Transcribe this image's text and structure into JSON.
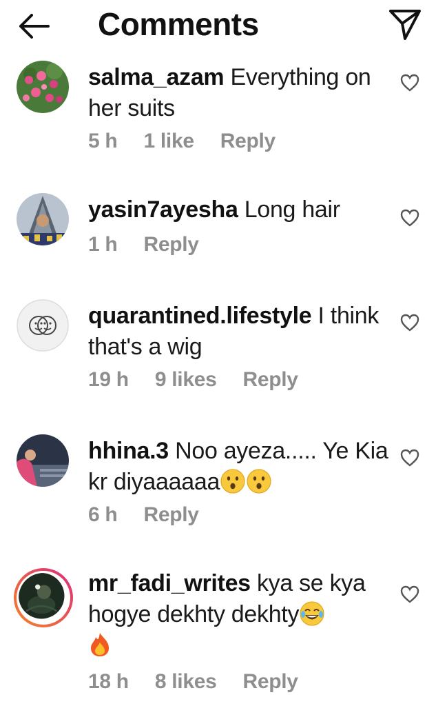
{
  "header": {
    "title": "Comments"
  },
  "comments": [
    {
      "username": "salma_azam",
      "text": "Everything on her suits",
      "time": "5 h",
      "likes": "1 like",
      "reply": "Reply"
    },
    {
      "username": "yasin7ayesha",
      "text": "Long hair",
      "time": "1 h",
      "likes": "",
      "reply": "Reply"
    },
    {
      "username": "quarantined.lifestyle",
      "text": "I think that's a wig",
      "time": "19 h",
      "likes": "9 likes",
      "reply": "Reply"
    },
    {
      "username": "hhina.3",
      "text": "Noo ayeza..... Ye Kia kr diyaaaaaa",
      "time": "6 h",
      "likes": "",
      "reply": "Reply"
    },
    {
      "username": "mr_fadi_writes",
      "text": "kya se kya hogye dekhty dekhty",
      "time": "18 h",
      "likes": "8 likes",
      "reply": "Reply"
    }
  ],
  "icons": {
    "back": "arrow-left-icon",
    "send": "paper-plane-icon",
    "like": "heart-outline-icon",
    "emoji_hushed": "hushed-face-emoji",
    "emoji_laugh": "tears-of-joy-emoji",
    "emoji_fire": "fire-emoji"
  },
  "colors": {
    "meta_text": "#8e8e8e",
    "story_ring_start": "#f58529",
    "story_ring_end": "#dd2a7b"
  }
}
